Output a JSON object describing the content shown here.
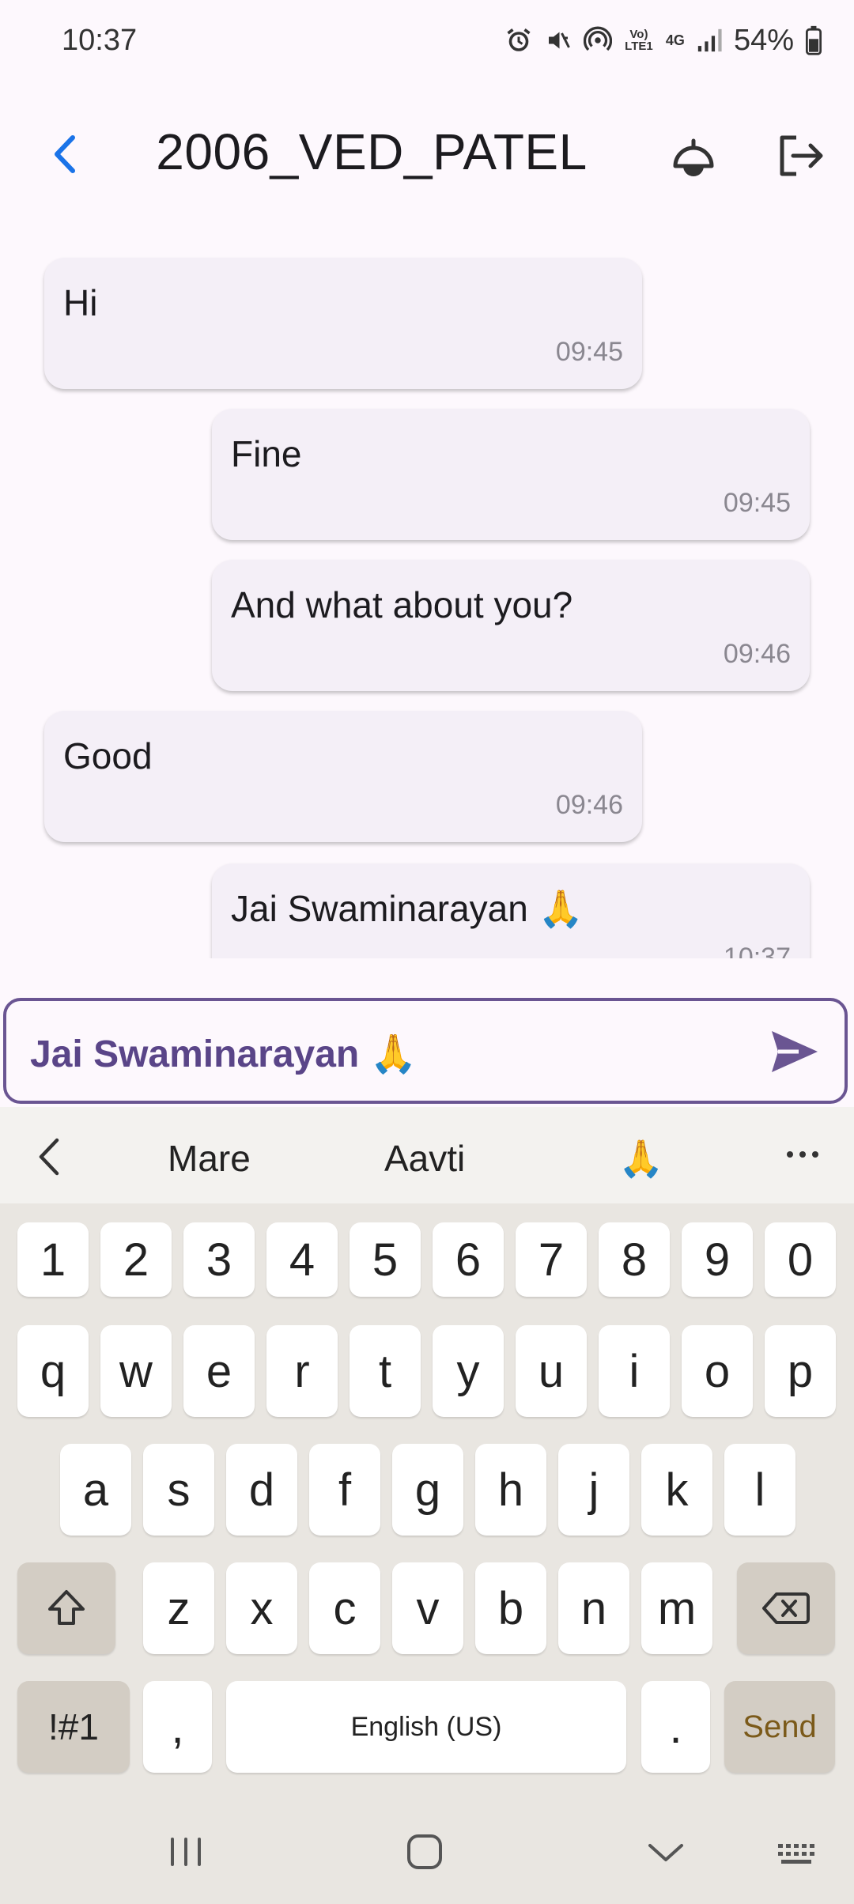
{
  "status_bar": {
    "time": "10:37",
    "battery": "54%",
    "network_label": "4G",
    "volte_label": "Vo) LTE1"
  },
  "header": {
    "title": "2006_VED_PATEL"
  },
  "messages": [
    {
      "side": "left",
      "text": "Hi",
      "time": "09:45"
    },
    {
      "side": "right",
      "text": "Fine",
      "time": "09:45"
    },
    {
      "side": "right",
      "text": "And what about you?",
      "time": "09:46"
    },
    {
      "side": "left",
      "text": "Good",
      "time": "09:46"
    },
    {
      "side": "right",
      "text": "Jai Swaminarayan 🙏",
      "time": "10:37"
    }
  ],
  "composer": {
    "value": "Jai Swaminarayan 🙏"
  },
  "suggestions": [
    "Mare",
    "Aavti",
    "🙏"
  ],
  "keyboard": {
    "row1": [
      "1",
      "2",
      "3",
      "4",
      "5",
      "6",
      "7",
      "8",
      "9",
      "0"
    ],
    "row2": [
      "q",
      "w",
      "e",
      "r",
      "t",
      "y",
      "u",
      "i",
      "o",
      "p"
    ],
    "row3": [
      "a",
      "s",
      "d",
      "f",
      "g",
      "h",
      "j",
      "k",
      "l"
    ],
    "row4": [
      "z",
      "x",
      "c",
      "v",
      "b",
      "n",
      "m"
    ],
    "symbols_label": "!#1",
    "comma_label": ",",
    "space_label": "English (US)",
    "period_label": ".",
    "send_label": "Send"
  },
  "colors": {
    "accent": "#6a5592",
    "back_arrow": "#1a73e8",
    "bubble": "#f4eff7",
    "background": "#fdf8fd"
  }
}
